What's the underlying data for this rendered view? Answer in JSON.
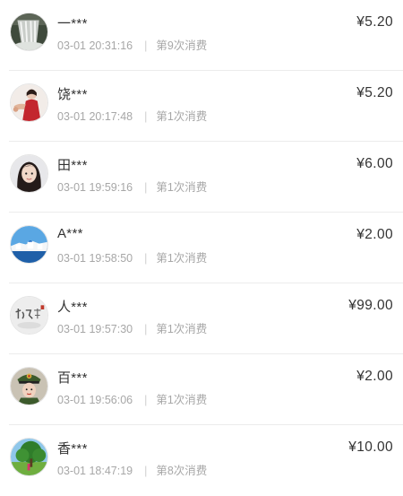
{
  "records": [
    {
      "name": "一***",
      "time": "03-01 20:31:16",
      "separator": "|",
      "count": "第9次消费",
      "amount": "¥5.20",
      "avatar": "waterfall-avatar-icon"
    },
    {
      "name": "饶***",
      "time": "03-01 20:17:48",
      "separator": "|",
      "count": "第1次消费",
      "amount": "¥5.20",
      "avatar": "woman-red-dress-avatar-icon"
    },
    {
      "name": "田***",
      "time": "03-01 19:59:16",
      "separator": "|",
      "count": "第1次消费",
      "amount": "¥6.00",
      "avatar": "girl-portrait-avatar-icon"
    },
    {
      "name": "A***",
      "time": "03-01 19:58:50",
      "separator": "|",
      "count": "第1次消费",
      "amount": "¥2.00",
      "avatar": "seaside-town-avatar-icon"
    },
    {
      "name": "人***",
      "time": "03-01 19:57:30",
      "separator": "|",
      "count": "第1次消费",
      "amount": "¥99.00",
      "avatar": "calligraphy-avatar-icon"
    },
    {
      "name": "百***",
      "time": "03-01 19:56:06",
      "separator": "|",
      "count": "第1次消费",
      "amount": "¥2.00",
      "avatar": "uniform-cap-avatar-icon"
    },
    {
      "name": "香***",
      "time": "03-01 18:47:19",
      "separator": "|",
      "count": "第8次消费",
      "amount": "¥10.00",
      "avatar": "tree-landscape-avatar-icon"
    }
  ]
}
